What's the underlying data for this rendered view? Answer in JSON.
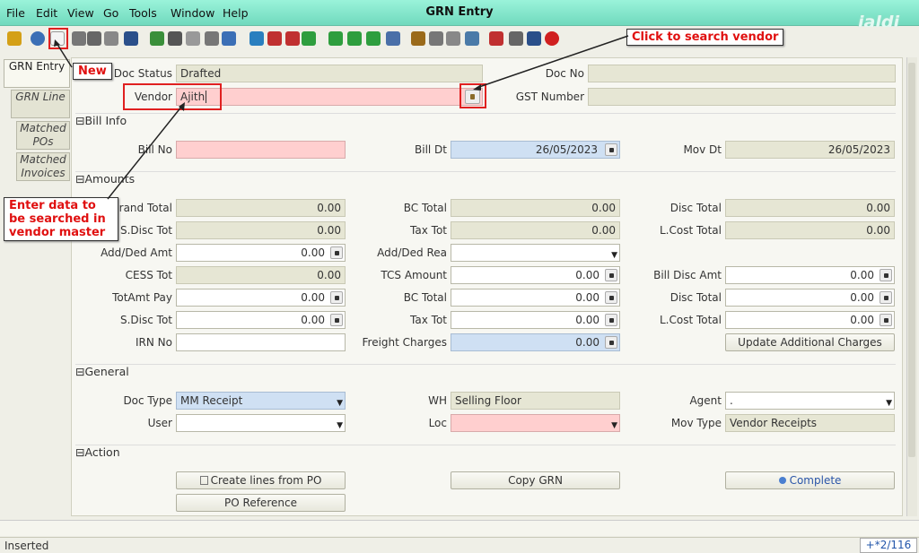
{
  "menu": [
    "File",
    "Edit",
    "View",
    "Go",
    "Tools",
    "Window",
    "Help"
  ],
  "window_title": "GRN Entry",
  "logo_text": "jaldi",
  "toolbar_icons": [
    "undo-icon",
    "help-icon",
    "new-icon",
    "copy-icon",
    "delete-icon",
    "delete-selection-icon",
    "save-icon",
    "refresh-icon",
    "find-icon",
    "attachment-icon",
    "chat-icon",
    "history-icon",
    "home-icon",
    "back-icon",
    "forward-icon",
    "first-record-icon",
    "previous-record-icon",
    "next-record-icon",
    "last-record-icon",
    "report-icon",
    "archive-icon",
    "print-icon",
    "print-preview-icon",
    "zoom-across-icon",
    "request-icon",
    "product-info-icon",
    "workflow-icon",
    "exit-icon"
  ],
  "tabs": [
    "GRN Entry",
    "GRN Line",
    "Matched POs",
    "Matched Invoices"
  ],
  "header": {
    "doc_status_label": "Doc Status",
    "doc_status": "Drafted",
    "doc_no_label": "Doc No",
    "doc_no": "",
    "vendor_label": "Vendor",
    "vendor": "Ajith",
    "gst_label": "GST Number",
    "gst": ""
  },
  "sections": {
    "bill_info": "Bill Info",
    "amounts": "Amounts",
    "general": "General",
    "action": "Action"
  },
  "bill": {
    "bill_no_label": "Bill No",
    "bill_no": "",
    "bill_dt_label": "Bill Dt",
    "bill_dt": "26/05/2023",
    "mov_dt_label": "Mov Dt",
    "mov_dt": "26/05/2023"
  },
  "amounts": {
    "grand_total_label": "Grand Total",
    "grand_total": "0.00",
    "bc_total_label": "BC Total",
    "bc_total": "0.00",
    "disc_total_label": "Disc Total",
    "disc_total": "0.00",
    "sdisc_tot_label": "S.Disc Tot",
    "sdisc_tot": "0.00",
    "tax_tot_label": "Tax Tot",
    "tax_tot": "0.00",
    "lcost_total_label": "L.Cost Total",
    "lcost_total": "0.00",
    "add_ded_amt_label": "Add/Ded Amt",
    "add_ded_amt": "0.00",
    "add_ded_rea_label": "Add/Ded Rea",
    "add_ded_rea": "",
    "cess_tot_label": "CESS Tot",
    "cess_tot": "0.00",
    "tcs_amount_label": "TCS Amount",
    "tcs_amount": "0.00",
    "bill_disc_amt_label": "Bill Disc Amt",
    "bill_disc_amt": "0.00",
    "totamt_pay_label": "TotAmt Pay",
    "totamt_pay": "0.00",
    "bc_total2_label": "BC Total",
    "bc_total2": "0.00",
    "disc_total2_label": "Disc Total",
    "disc_total2": "0.00",
    "sdisc_tot2_label": "S.Disc Tot",
    "sdisc_tot2": "0.00",
    "tax_tot2_label": "Tax Tot",
    "tax_tot2": "0.00",
    "lcost_total2_label": "L.Cost Total",
    "lcost_total2": "0.00",
    "irn_no_label": "IRN No",
    "irn_no": "",
    "freight_label": "Freight Charges",
    "freight": "0.00",
    "update_charges_button": "Update Additional Charges"
  },
  "general": {
    "doc_type_label": "Doc Type",
    "doc_type": "MM Receipt",
    "wh_label": "WH",
    "wh": "Selling Floor",
    "agent_label": "Agent",
    "agent": ".",
    "user_label": "User",
    "user": "",
    "loc_label": "Loc",
    "loc": "",
    "mov_type_label": "Mov Type",
    "mov_type": "Vendor Receipts"
  },
  "actions": {
    "create_lines": "Create lines from PO",
    "copy_grn": "Copy GRN",
    "complete": "Complete",
    "po_reference": "PO Reference"
  },
  "callouts": {
    "new": "New",
    "search_vendor": "Click to search vendor",
    "enter_data": "Enter data to be searched in vendor master"
  },
  "status": {
    "left": "Inserted",
    "right": "+*2/116"
  },
  "colors": {
    "titlebar": "#7fe3c8",
    "required": "#ffcfcf",
    "readonly": "#e6e6d4",
    "date": "#cfe0f3",
    "annotation": "#e01010"
  }
}
